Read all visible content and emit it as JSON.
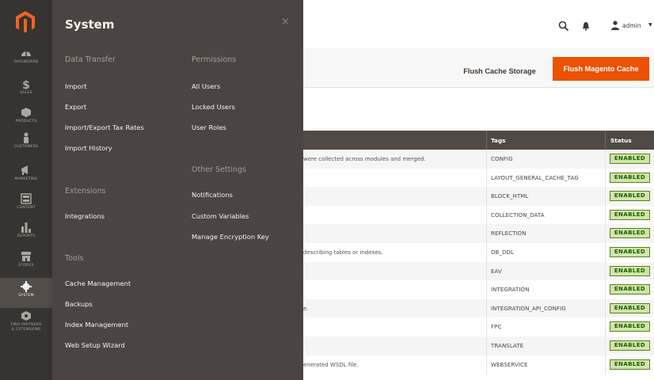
{
  "nav": {
    "items": [
      {
        "label": "DASHBOARD",
        "icon": "dashboard-icon"
      },
      {
        "label": "SALES",
        "icon": "dollar-icon"
      },
      {
        "label": "PRODUCTS",
        "icon": "box-icon"
      },
      {
        "label": "CUSTOMERS",
        "icon": "person-icon"
      },
      {
        "label": "MARKETING",
        "icon": "megaphone-icon"
      },
      {
        "label": "CONTENT",
        "icon": "layout-icon"
      },
      {
        "label": "REPORTS",
        "icon": "bar-chart-icon"
      },
      {
        "label": "STORES",
        "icon": "store-icon"
      },
      {
        "label": "SYSTEM",
        "icon": "gear-icon"
      },
      {
        "label": "FIND PARTNERS",
        "label2": "& EXTENSIONS",
        "icon": "partners-icon"
      }
    ]
  },
  "panel": {
    "title": "System",
    "close": "×",
    "sections": {
      "data_transfer": {
        "heading": "Data Transfer",
        "links": [
          "Import",
          "Export",
          "Import/Export Tax Rates",
          "Import History"
        ]
      },
      "extensions": {
        "heading": "Extensions",
        "links": [
          "Integrations"
        ]
      },
      "tools": {
        "heading": "Tools",
        "links": [
          "Cache Management",
          "Backups",
          "Index Management",
          "Web Setup Wizard"
        ]
      },
      "permissions": {
        "heading": "Permissions",
        "links": [
          "All Users",
          "Locked Users",
          "User Roles"
        ]
      },
      "other_settings": {
        "heading": "Other Settings",
        "links": [
          "Notifications",
          "Custom Variables",
          "Manage Encryption Key"
        ]
      }
    }
  },
  "header": {
    "user": "admin"
  },
  "toolbar": {
    "flush_storage": "Flush Cache Storage",
    "flush_magento": "Flush Magento Cache"
  },
  "table": {
    "headers": {
      "tags": "Tags",
      "status": "Status"
    },
    "rows": [
      {
        "desc": "were collected across modules and merged.",
        "tag": "CONFIG",
        "status": "ENABLED"
      },
      {
        "desc": "",
        "tag": "LAYOUT_GENERAL_CACHE_TAG",
        "status": "ENABLED"
      },
      {
        "desc": "",
        "tag": "BLOCK_HTML",
        "status": "ENABLED"
      },
      {
        "desc": "",
        "tag": "COLLECTION_DATA",
        "status": "ENABLED"
      },
      {
        "desc": "",
        "tag": "REFLECTION",
        "status": "ENABLED"
      },
      {
        "desc": "describing tables or indexes.",
        "tag": "DB_DDL",
        "status": "ENABLED"
      },
      {
        "desc": "",
        "tag": "EAV",
        "status": "ENABLED"
      },
      {
        "desc": "",
        "tag": "INTEGRATION",
        "status": "ENABLED"
      },
      {
        "desc": "e.",
        "tag": "INTEGRATION_API_CONFIG",
        "status": "ENABLED"
      },
      {
        "desc": "",
        "tag": "FPC",
        "status": "ENABLED"
      },
      {
        "desc": "",
        "tag": "TRANSLATE",
        "status": "ENABLED"
      },
      {
        "desc": "enerated WSDL file.",
        "tag": "WEBSERVICE",
        "status": "ENABLED"
      }
    ]
  },
  "colors": {
    "nav_bg": "#373330",
    "panel_bg": "#4a4542",
    "accent": "#eb5202",
    "enabled_bg": "#d0e5a9"
  }
}
